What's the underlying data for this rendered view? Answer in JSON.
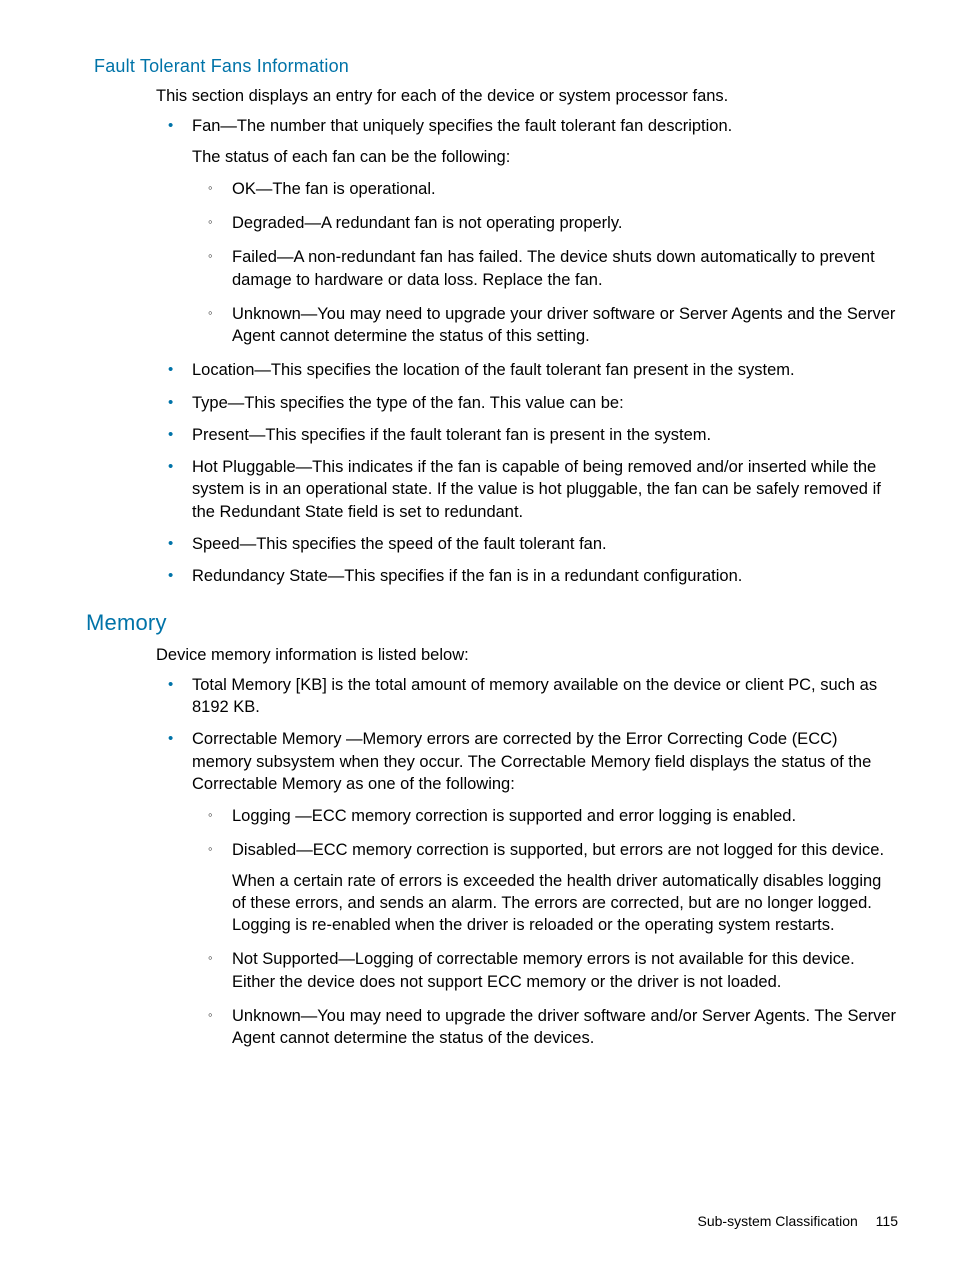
{
  "section1": {
    "heading": "Fault Tolerant Fans Information",
    "intro": "This section displays an entry for each of the device or system processor fans.",
    "items": [
      {
        "text": "Fan—The number that uniquely specifies the fault tolerant fan description.",
        "extra": "The status of each fan can be the following:",
        "sub": [
          "OK—The fan is operational.",
          "Degraded—A redundant fan is not operating properly.",
          "Failed—A non-redundant fan has failed. The device shuts down automatically to prevent damage to hardware or data loss. Replace the fan.",
          "Unknown—You may need to upgrade your driver software or Server Agents and the Server Agent cannot determine the status of this setting."
        ]
      },
      {
        "text": "Location—This specifies the location of the fault tolerant fan present in the system."
      },
      {
        "text": "Type—This specifies the type of the fan. This value can be:"
      },
      {
        "text": "Present—This specifies if the fault tolerant fan is present in the system."
      },
      {
        "text": "Hot Pluggable—This indicates if the fan is capable of being removed and/or inserted while the system is in an operational state. If the value is hot pluggable, the fan can be safely removed if the Redundant State field is set to redundant."
      },
      {
        "text": "Speed—This specifies the speed of the fault tolerant fan."
      },
      {
        "text": "Redundancy State—This specifies if the fan is in a redundant configuration."
      }
    ]
  },
  "section2": {
    "heading": "Memory",
    "intro": "Device memory information is listed below:",
    "items": [
      {
        "text": "Total Memory [KB] is the total amount of memory available on the device or client PC, such as 8192 KB."
      },
      {
        "text": "Correctable Memory —Memory errors are corrected by the Error Correcting Code (ECC) memory subsystem when they occur. The Correctable Memory field displays the status of the Correctable Memory as one of the following:",
        "sub": [
          "Logging —ECC memory correction is supported and error logging is enabled.",
          {
            "text": "Disabled—ECC memory correction is supported, but errors are not logged for this device.",
            "extra": "When a certain rate of errors is exceeded the health driver automatically disables logging of these errors, and sends an alarm. The errors are corrected, but are no longer logged. Logging is re-enabled when the driver is reloaded or the operating system restarts."
          },
          "Not Supported—Logging of correctable memory errors is not available for this device. Either the device does not support ECC memory or the driver is not loaded.",
          "Unknown—You may need to upgrade the driver software and/or Server Agents. The Server Agent cannot determine the status of the devices."
        ]
      }
    ]
  },
  "footer": {
    "title": "Sub-system Classification",
    "page": "115"
  }
}
